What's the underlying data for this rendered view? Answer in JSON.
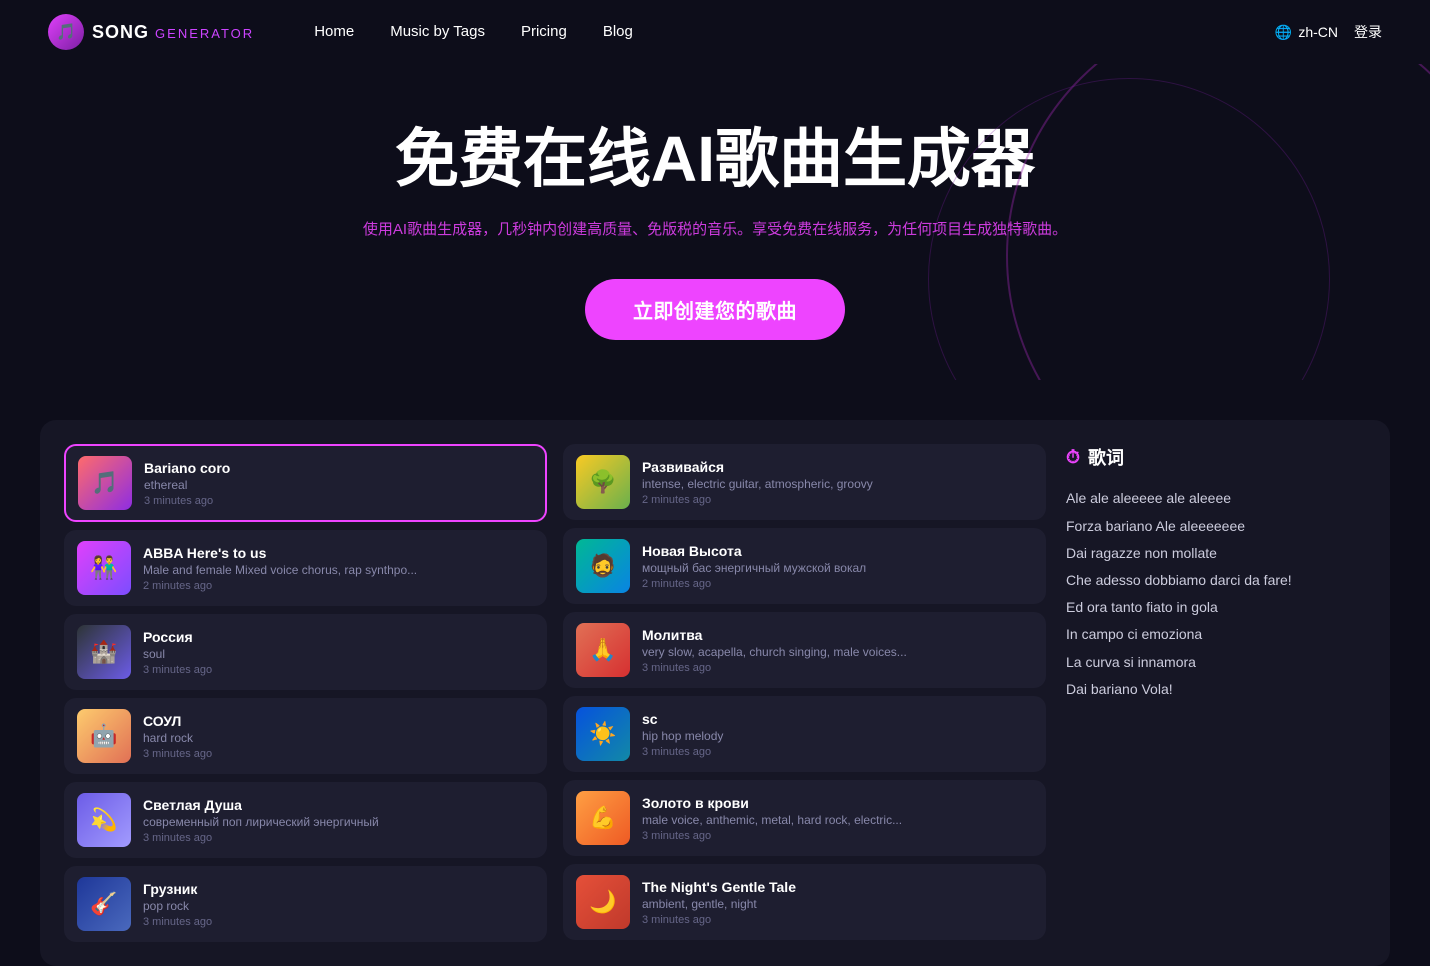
{
  "nav": {
    "logo_song": "SONG",
    "logo_generator": "GENERATOR",
    "links": [
      {
        "id": "home",
        "label": "Home"
      },
      {
        "id": "music-by-tags",
        "label": "Music by Tags"
      },
      {
        "id": "pricing",
        "label": "Pricing"
      },
      {
        "id": "blog",
        "label": "Blog"
      }
    ],
    "lang": "zh-CN",
    "login": "登录"
  },
  "hero": {
    "title": "免费在线AI歌曲生成器",
    "subtitle": "使用AI歌曲生成器，几秒钟内创建高质量、免版税的音乐。享受免费在线服务，为任何项目生成独特歌曲。",
    "cta": "立即创建您的歌曲"
  },
  "lyrics": {
    "header": "歌词",
    "lines": [
      "Ale ale aleeeee ale aleeee",
      "Forza bariano Ale aleeeeeee",
      "Dai ragazze non mollate",
      "Che adesso dobbiamo darci da fare!",
      "Ed ora tanto fiato in gola",
      "In campo ci emoziona",
      "La curva si innamora",
      "Dai bariano Vola!"
    ]
  },
  "songs_left": [
    {
      "id": "bariano-coro",
      "title": "Bariano coro",
      "tags": "ethereal",
      "time": "3 minutes ago",
      "active": true,
      "thumb": "thumb-1",
      "icon": "🎵"
    },
    {
      "id": "abba-heres-to-us",
      "title": "ABBA Here's to us",
      "tags": "Male and female Mixed voice chorus, rap synthpo...",
      "time": "2 minutes ago",
      "active": false,
      "thumb": "thumb-3",
      "icon": "👫"
    },
    {
      "id": "rossiya",
      "title": "Россия",
      "tags": "soul",
      "time": "3 minutes ago",
      "active": false,
      "thumb": "thumb-5",
      "icon": "🏰"
    },
    {
      "id": "soul",
      "title": "СОУЛ",
      "tags": "hard rock",
      "time": "3 minutes ago",
      "active": false,
      "thumb": "thumb-7",
      "icon": "🤖"
    },
    {
      "id": "svetlaya-dusha",
      "title": "Светлая Душа",
      "tags": "современный поп лирический энергичный",
      "time": "3 minutes ago",
      "active": false,
      "thumb": "thumb-9",
      "icon": "💫"
    },
    {
      "id": "gruznik",
      "title": "Грузник",
      "tags": "pop rock",
      "time": "3 minutes ago",
      "active": false,
      "thumb": "thumb-11",
      "icon": "🎸"
    }
  ],
  "songs_right": [
    {
      "id": "razvivajsya",
      "title": "Развивайся",
      "tags": "intense, electric guitar, atmospheric, groovy",
      "time": "2 minutes ago",
      "active": false,
      "thumb": "thumb-2",
      "icon": "🌳"
    },
    {
      "id": "novaya-vysota",
      "title": "Новая Высота",
      "tags": "мощный бас энергичный мужской вокал",
      "time": "2 minutes ago",
      "active": false,
      "thumb": "thumb-4",
      "icon": "🧔"
    },
    {
      "id": "molitva",
      "title": "Молитва",
      "tags": "very slow, acapella, church singing, male voices...",
      "time": "3 minutes ago",
      "active": false,
      "thumb": "thumb-6",
      "icon": "🙏"
    },
    {
      "id": "sc",
      "title": "sc",
      "tags": "hip hop melody",
      "time": "3 minutes ago",
      "active": false,
      "thumb": "thumb-8",
      "icon": "☀️"
    },
    {
      "id": "zoloto-v-krovi",
      "title": "Золото в крови",
      "tags": "male voice, anthemic, metal, hard rock, electric...",
      "time": "3 minutes ago",
      "active": false,
      "thumb": "thumb-10",
      "icon": "💪"
    },
    {
      "id": "the-nights-gentle-tale",
      "title": "The Night's Gentle Tale",
      "tags": "ambient, gentle, night",
      "time": "3 minutes ago",
      "active": false,
      "thumb": "thumb-12",
      "icon": "🌙"
    }
  ]
}
